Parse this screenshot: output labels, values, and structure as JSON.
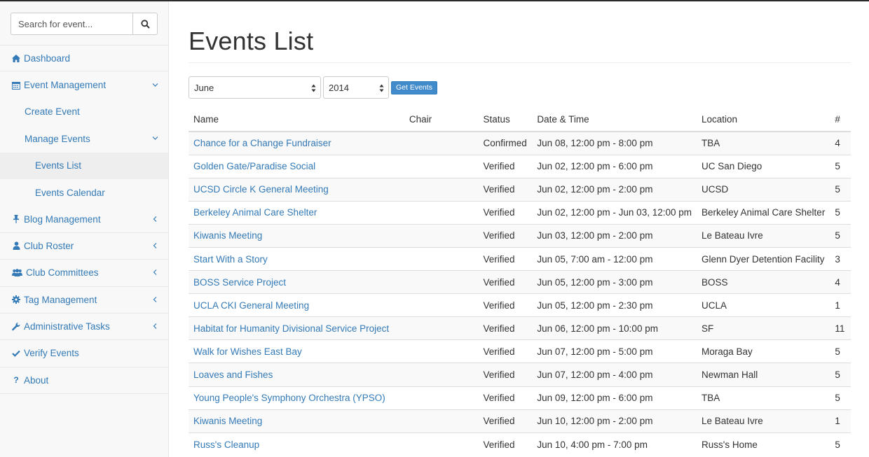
{
  "sidebar": {
    "search": {
      "placeholder": "Search for event..."
    },
    "items": [
      {
        "label": "Dashboard"
      },
      {
        "label": "Event Management"
      },
      {
        "label": "Create Event"
      },
      {
        "label": "Manage Events"
      },
      {
        "label": "Events List"
      },
      {
        "label": "Events Calendar"
      },
      {
        "label": "Blog Management"
      },
      {
        "label": "Club Roster"
      },
      {
        "label": "Club Committees"
      },
      {
        "label": "Tag Management"
      },
      {
        "label": "Administrative Tasks"
      },
      {
        "label": "Verify Events"
      },
      {
        "label": "About"
      }
    ]
  },
  "main": {
    "title": "Events List",
    "filters": {
      "month": "June",
      "year": "2014",
      "button": "Get Events"
    },
    "table": {
      "headers": [
        "Name",
        "Chair",
        "Status",
        "Date & Time",
        "Location",
        "#"
      ],
      "rows": [
        {
          "name": "Chance for a Change Fundraiser",
          "chair": "",
          "status": "Confirmed",
          "datetime": "Jun 08, 12:00 pm - 8:00 pm",
          "location": "TBA",
          "count": "4"
        },
        {
          "name": "Golden Gate/Paradise Social",
          "chair": "",
          "status": "Verified",
          "datetime": "Jun 02, 12:00 pm - 6:00 pm",
          "location": "UC San Diego",
          "count": "5"
        },
        {
          "name": "UCSD Circle K General Meeting",
          "chair": "",
          "status": "Verified",
          "datetime": "Jun 02, 12:00 pm - 2:00 pm",
          "location": "UCSD",
          "count": "5"
        },
        {
          "name": "Berkeley Animal Care Shelter",
          "chair": "",
          "status": "Verified",
          "datetime": "Jun 02, 12:00 pm - Jun 03, 12:00 pm",
          "location": "Berkeley Animal Care Shelter",
          "count": "5"
        },
        {
          "name": "Kiwanis Meeting",
          "chair": "",
          "status": "Verified",
          "datetime": "Jun 03, 12:00 pm - 2:00 pm",
          "location": "Le Bateau Ivre",
          "count": "5"
        },
        {
          "name": "Start With a Story",
          "chair": "",
          "status": "Verified",
          "datetime": "Jun 05, 7:00 am - 12:00 pm",
          "location": "Glenn Dyer Detention Facility",
          "count": "3"
        },
        {
          "name": "BOSS Service Project",
          "chair": "",
          "status": "Verified",
          "datetime": "Jun 05, 12:00 pm - 3:00 pm",
          "location": "BOSS",
          "count": "4"
        },
        {
          "name": "UCLA CKI General Meeting",
          "chair": "",
          "status": "Verified",
          "datetime": "Jun 05, 12:00 pm - 2:30 pm",
          "location": "UCLA",
          "count": "1"
        },
        {
          "name": "Habitat for Humanity Divisional Service Project",
          "chair": "",
          "status": "Verified",
          "datetime": "Jun 06, 12:00 pm - 10:00 pm",
          "location": "SF",
          "count": "11"
        },
        {
          "name": "Walk for Wishes East Bay",
          "chair": "",
          "status": "Verified",
          "datetime": "Jun 07, 12:00 pm - 5:00 pm",
          "location": "Moraga Bay",
          "count": "5"
        },
        {
          "name": "Loaves and Fishes",
          "chair": "",
          "status": "Verified",
          "datetime": "Jun 07, 12:00 pm - 4:00 pm",
          "location": "Newman Hall",
          "count": "5"
        },
        {
          "name": "Young People's Symphony Orchestra (YPSO)",
          "chair": "",
          "status": "Verified",
          "datetime": "Jun 09, 12:00 pm - 6:00 pm",
          "location": "TBA",
          "count": "5"
        },
        {
          "name": "Kiwanis Meeting",
          "chair": "",
          "status": "Verified",
          "datetime": "Jun 10, 12:00 pm - 2:00 pm",
          "location": "Le Bateau Ivre",
          "count": "1"
        },
        {
          "name": "Russ's Cleanup",
          "chair": "",
          "status": "Verified",
          "datetime": "Jun 10, 4:00 pm - 7:00 pm",
          "location": "Russ's Home",
          "count": "5"
        }
      ]
    }
  },
  "colors": {
    "link": "#337ab7",
    "button": "#428bca",
    "sidebar_bg": "#f8f8f8"
  }
}
